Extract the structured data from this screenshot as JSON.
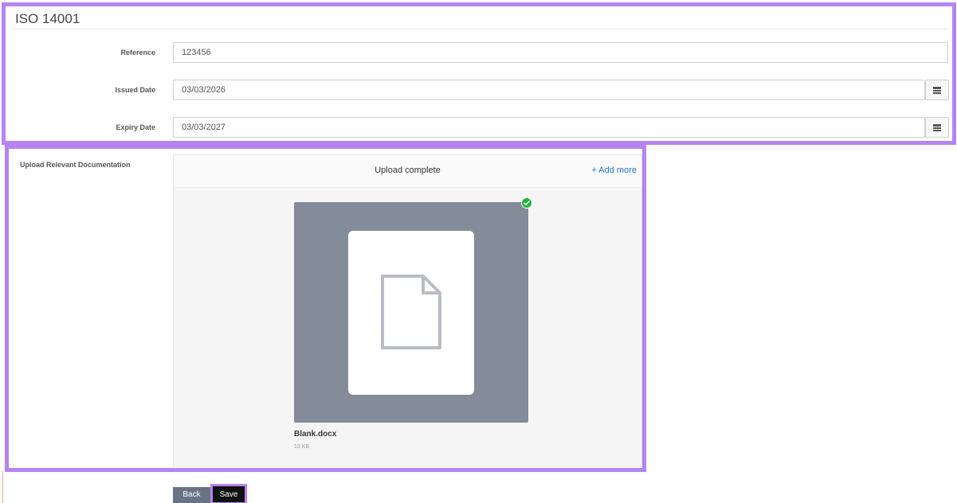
{
  "section": {
    "title": "ISO 14001"
  },
  "fields": {
    "reference": {
      "label": "Reference",
      "value": "123456"
    },
    "issued_date": {
      "label": "Issued Date",
      "value": "03/03/2026",
      "icon": "calendar-icon"
    },
    "expiry_date": {
      "label": "Expiry Date",
      "value": "03/03/2027",
      "icon": "calendar-icon"
    }
  },
  "upload": {
    "label": "Upload Relevant Documentation",
    "status": "Upload complete",
    "add_more": "+ Add more",
    "file": {
      "name": "Blank.docx",
      "size": "13 KB",
      "status_icon": "check-circle-icon"
    }
  },
  "actions": {
    "back_label": "Back",
    "save_label": "Save"
  },
  "colors": {
    "highlight": "#b584f0",
    "link": "#2275d7",
    "success": "#1bb240",
    "thumbnail": "#848b99"
  }
}
